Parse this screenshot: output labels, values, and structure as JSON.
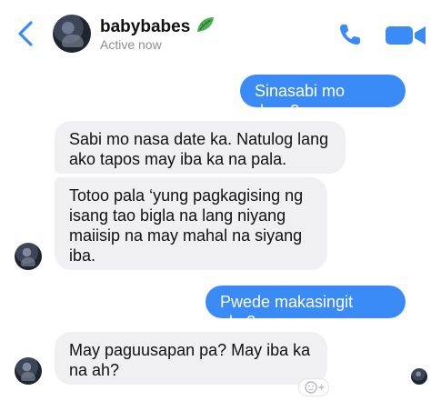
{
  "header": {
    "name": "babybabes",
    "status": "Active now",
    "icons": [
      "back-chevron-icon",
      "leaf-emoji-icon",
      "phone-icon",
      "video-camera-icon"
    ],
    "accent_color": "#3a8bf6"
  },
  "messages": [
    {
      "sender": "me",
      "text": "Sinasabi mo dyan?"
    },
    {
      "sender": "them",
      "text": "Sabi mo nasa date ka. Natulog lang\nako tapos may iba ka na pala."
    },
    {
      "sender": "them",
      "text": "Totoo pala ‘yung pagkagising ng\nisang tao bigla na lang niyang\nmaiisip na may mahal na siyang\niba."
    },
    {
      "sender": "me",
      "text": "Pwede makasingit ako?"
    },
    {
      "sender": "them",
      "text": "May paguusapan pa? May iba ka\nna ah?"
    }
  ],
  "colors": {
    "outgoing_bubble": "#3a8bf6",
    "incoming_bubble": "#f0f0f2"
  }
}
